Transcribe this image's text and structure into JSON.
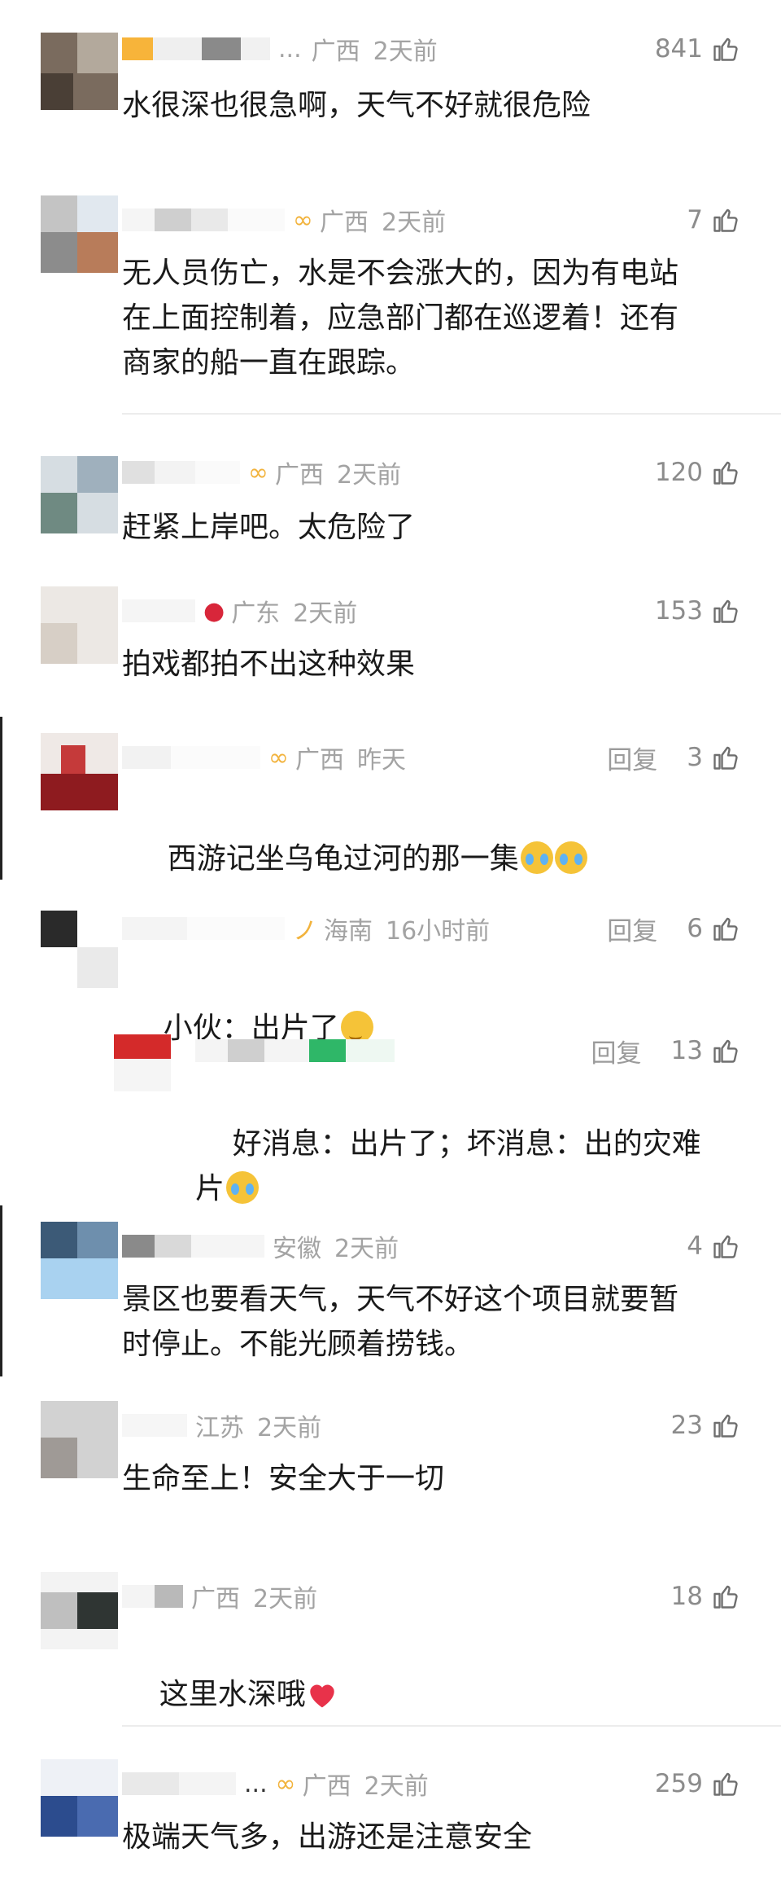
{
  "comments": [
    {
      "location": "广西",
      "time": "2天前",
      "likes": "841",
      "reply": "",
      "ellipsis": "...",
      "text": "水很深也很急啊，天气不好就很危险"
    },
    {
      "location": "广西",
      "time": "2天前",
      "likes": "7",
      "reply": "",
      "text": "无人员伤亡，水是不会涨大的，因为有电站\n在上面控制着，应急部门都在巡逻着！还有\n商家的船一直在跟踪。"
    },
    {
      "location": "广西",
      "time": "2天前",
      "likes": "120",
      "reply": "",
      "text": "赶紧上岸吧。太危险了"
    },
    {
      "location": "广东",
      "time": "2天前",
      "likes": "153",
      "reply": "",
      "text": "拍戏都拍不出这种效果"
    },
    {
      "location": "广西",
      "time": "昨天",
      "likes": "3",
      "reply": "回复",
      "text": "西游记坐乌龟过河的那一集"
    },
    {
      "location": "海南",
      "time": "16小时前",
      "likes": "6",
      "reply": "回复",
      "text": "小伙：出片了"
    },
    {
      "location": "",
      "time": "",
      "likes": "13",
      "reply": "回复",
      "text": "好消息：出片了；坏消息：出的灾难\n片"
    },
    {
      "location": "安徽",
      "time": "2天前",
      "likes": "4",
      "reply": "",
      "text": "景区也要看天气，天气不好这个项目就要暂\n时停止。不能光顾着捞钱。"
    },
    {
      "location": "江苏",
      "time": "2天前",
      "likes": "23",
      "reply": "",
      "text": "生命至上！安全大于一切"
    },
    {
      "location": "广西",
      "time": "2天前",
      "likes": "18",
      "reply": "",
      "text": "这里水深哦"
    },
    {
      "location": "广西",
      "time": "2天前",
      "likes": "259",
      "reply": "",
      "ellipsis": "...",
      "text": "极端天气多，出游还是注意安全"
    }
  ],
  "colors": {
    "meta": "#a3a3a3",
    "text": "#1a1a1a",
    "divider": "#ececec"
  },
  "icons": {
    "like": "thumbs-up-icon",
    "cry": "crying-laughing-emoji",
    "think": "thinking-emoji",
    "heart": "red-heart-emoji"
  }
}
